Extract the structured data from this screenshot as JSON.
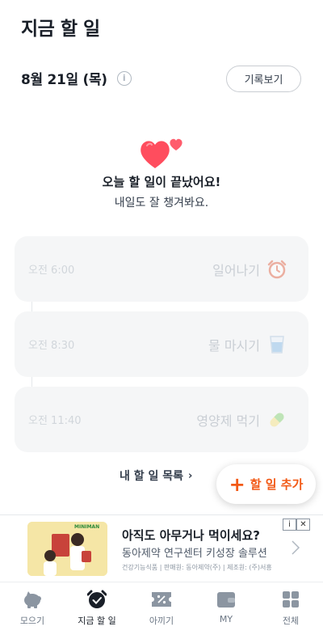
{
  "header": {
    "title": "지금 할 일"
  },
  "date_row": {
    "date": "8월 21일 (목)",
    "info_icon": "info-icon",
    "history_button": "기록보기"
  },
  "completion": {
    "icon": "hearts-icon",
    "title": "오늘 할 일이 끝났어요!",
    "subtitle": "내일도 잘 챙겨봐요."
  },
  "tasks": [
    {
      "time": "오전 6:00",
      "name": "일어나기",
      "icon": "alarm-clock-icon"
    },
    {
      "time": "오전 8:30",
      "name": "물 마시기",
      "icon": "water-cup-icon"
    },
    {
      "time": "오전 11:40",
      "name": "영양제 먹기",
      "icon": "pill-icon"
    }
  ],
  "list_link": {
    "label": "내 할 일 목록",
    "chevron": "›"
  },
  "add_button": {
    "plus": "+",
    "label": "할 일 추가"
  },
  "ad": {
    "brand": "MINIMAN",
    "title": "아직도 아무거나 먹이세요?",
    "subtitle": "동아제약 연구센터 키성장 솔루션",
    "fine_print": "건강기능식품 | 판매원: 동아제약(주) | 제조원: (주)서흥",
    "info_badge": "i",
    "close_badge": "✕"
  },
  "tabs": [
    {
      "label": "모으기",
      "icon": "piggy-bank-icon",
      "active": false
    },
    {
      "label": "지금 할 일",
      "icon": "alarm-check-icon",
      "active": true
    },
    {
      "label": "아끼기",
      "icon": "discount-coupon-icon",
      "active": false
    },
    {
      "label": "MY",
      "icon": "wallet-icon",
      "active": false
    },
    {
      "label": "전체",
      "icon": "grid-icon",
      "active": false
    }
  ],
  "colors": {
    "accent": "#f25a17",
    "heart": "#ff4d5e",
    "text": "#191f28",
    "card": "#f5f6f7"
  }
}
